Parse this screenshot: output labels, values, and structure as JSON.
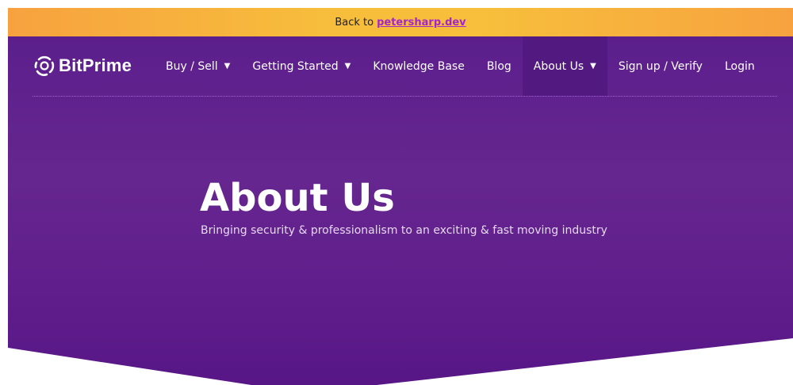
{
  "banner": {
    "prefix": "Back to",
    "link_text": "petersharp.dev"
  },
  "brand": {
    "name": "BitPrime",
    "logo_icon": "bitprime-logo-icon"
  },
  "nav": {
    "items": [
      {
        "label": "Buy / Sell",
        "caret": "▼"
      },
      {
        "label": "Getting Started",
        "caret": "▼"
      },
      {
        "label": "Knowledge Base"
      },
      {
        "label": "Blog"
      },
      {
        "label": "About Us",
        "caret": "▼",
        "active": true
      },
      {
        "label": "Sign up / Verify"
      },
      {
        "label": "Login"
      }
    ]
  },
  "hero": {
    "title": "About Us",
    "subtitle": "Bringing security & professionalism to an exciting & fast moving industry"
  },
  "colors": {
    "banner": "#f7bd3c",
    "hero": "#611f8e",
    "link": "#a526c9",
    "active_nav": "#521a80"
  }
}
